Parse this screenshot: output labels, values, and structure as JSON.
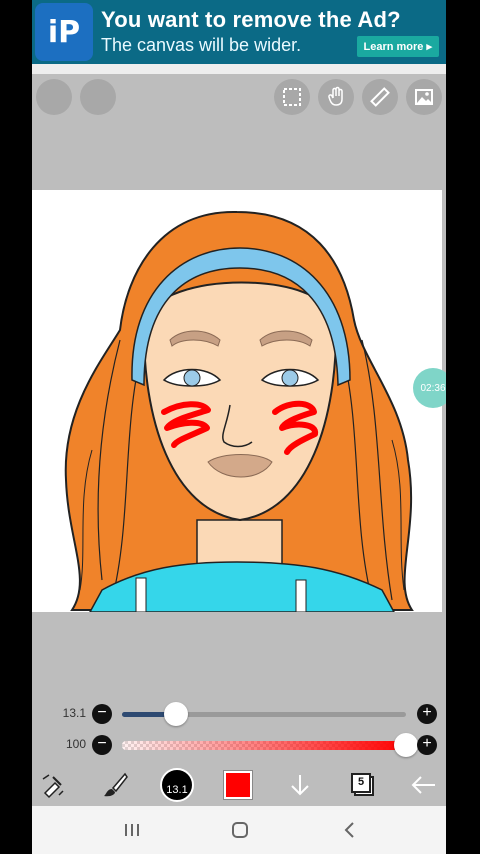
{
  "ad": {
    "logo_text": "iP",
    "title": "You want to remove the Ad?",
    "subtitle": "The canvas will be wider.",
    "button_label": "Learn more ▸"
  },
  "top_icons": [
    "select-icon",
    "hand-icon",
    "ruler-icon",
    "image-icon"
  ],
  "timer": {
    "label": "02:36"
  },
  "brush_slider": {
    "label": "13.1",
    "value_fraction": 0.19
  },
  "opacity_slider": {
    "label": "100",
    "value_fraction": 1.0
  },
  "toolbar": {
    "brush_size_label": "13.1",
    "color": "#ff0000",
    "layers_count": "5"
  },
  "colors": {
    "hair": "#f0832a",
    "skin": "#fbd9b6",
    "headband": "#7ec6ec",
    "shirt": "#35d6ea",
    "blush": "#ff0000"
  }
}
